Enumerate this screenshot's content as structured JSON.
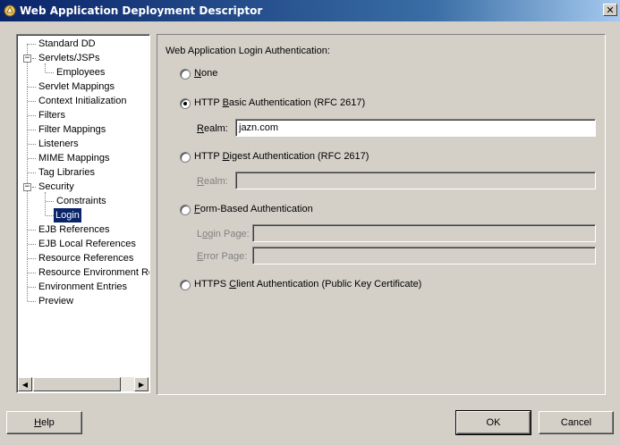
{
  "window": {
    "title": "Web Application Deployment Descriptor",
    "close_glyph": "✕"
  },
  "tree": {
    "items": [
      {
        "label": "Standard DD"
      },
      {
        "label": "Servlets/JSPs",
        "expander": "−"
      },
      {
        "label": "Employees"
      },
      {
        "label": "Servlet Mappings"
      },
      {
        "label": "Context Initialization"
      },
      {
        "label": "Filters"
      },
      {
        "label": "Filter Mappings"
      },
      {
        "label": "Listeners"
      },
      {
        "label": "MIME Mappings"
      },
      {
        "label": "Tag Libraries"
      },
      {
        "label": "Security",
        "expander": "−"
      },
      {
        "label": "Constraints"
      },
      {
        "label": "Login",
        "selected": true
      },
      {
        "label": "EJB References"
      },
      {
        "label": "EJB Local References"
      },
      {
        "label": "Resource References"
      },
      {
        "label": "Resource Environment Re"
      },
      {
        "label": "Environment Entries"
      },
      {
        "label": "Preview"
      }
    ],
    "scroll_left_glyph": "◀",
    "scroll_right_glyph": "▶"
  },
  "login": {
    "heading": "Web Application Login Authentication:",
    "options": {
      "none": {
        "pre": "",
        "key": "N",
        "post": "one",
        "checked": false
      },
      "basic": {
        "pre": "HTTP ",
        "key": "B",
        "post": "asic Authentication (RFC 2617)",
        "checked": true
      },
      "digest": {
        "pre": "HTTP ",
        "key": "D",
        "post": "igest Authentication (RFC 2617)",
        "checked": false
      },
      "form": {
        "pre": "",
        "key": "F",
        "post": "orm-Based Authentication",
        "checked": false
      },
      "https": {
        "pre": "HTTPS ",
        "key": "C",
        "post": "lient Authentication (Public Key Certificate)",
        "checked": false
      }
    },
    "basic_realm": {
      "key": "R",
      "post": "ealm:",
      "value": "jazn.com"
    },
    "digest_realm": {
      "key": "R",
      "post": "ealm:",
      "value": ""
    },
    "login_page": {
      "pre": "L",
      "key": "o",
      "post": "gin Page:",
      "value": ""
    },
    "error_page": {
      "pre": "",
      "key": "E",
      "post": "rror Page:",
      "value": ""
    }
  },
  "buttons": {
    "help": {
      "key": "H",
      "post": "elp"
    },
    "ok": "OK",
    "cancel": "Cancel"
  },
  "colors": {
    "titlebar_start": "#0a246a",
    "titlebar_end": "#a6caf0",
    "dialog_bg": "#d4d0c8",
    "selection": "#0a246a"
  }
}
